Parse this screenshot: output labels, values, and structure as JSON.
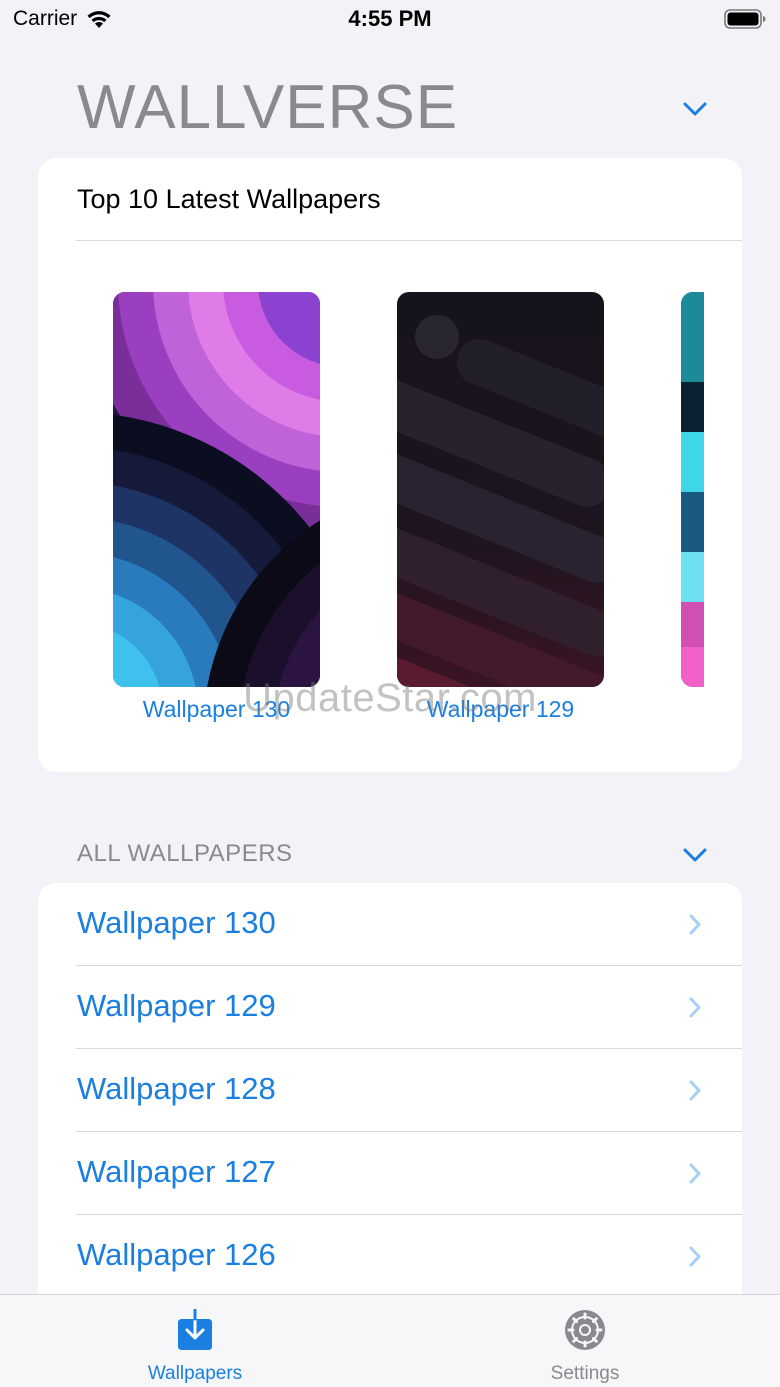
{
  "status_bar": {
    "carrier": "Carrier",
    "time": "4:55 PM"
  },
  "header": {
    "title": "WALLVERSE"
  },
  "top_section": {
    "title": "Top 10 Latest Wallpapers",
    "items": [
      {
        "label": "Wallpaper 130"
      },
      {
        "label": "Wallpaper 129"
      }
    ]
  },
  "watermark": "UpdateStar.com",
  "all_section": {
    "header": "ALL WALLPAPERS",
    "items": [
      {
        "label": "Wallpaper 130"
      },
      {
        "label": "Wallpaper 129"
      },
      {
        "label": "Wallpaper 128"
      },
      {
        "label": "Wallpaper 127"
      },
      {
        "label": "Wallpaper 126"
      }
    ]
  },
  "tab_bar": {
    "tabs": [
      {
        "label": "Wallpapers",
        "active": true
      },
      {
        "label": "Settings",
        "active": false
      }
    ]
  },
  "colors": {
    "accent": "#1a7fe0",
    "background": "#f2f2f7",
    "secondary_text": "#8a8a8e"
  }
}
